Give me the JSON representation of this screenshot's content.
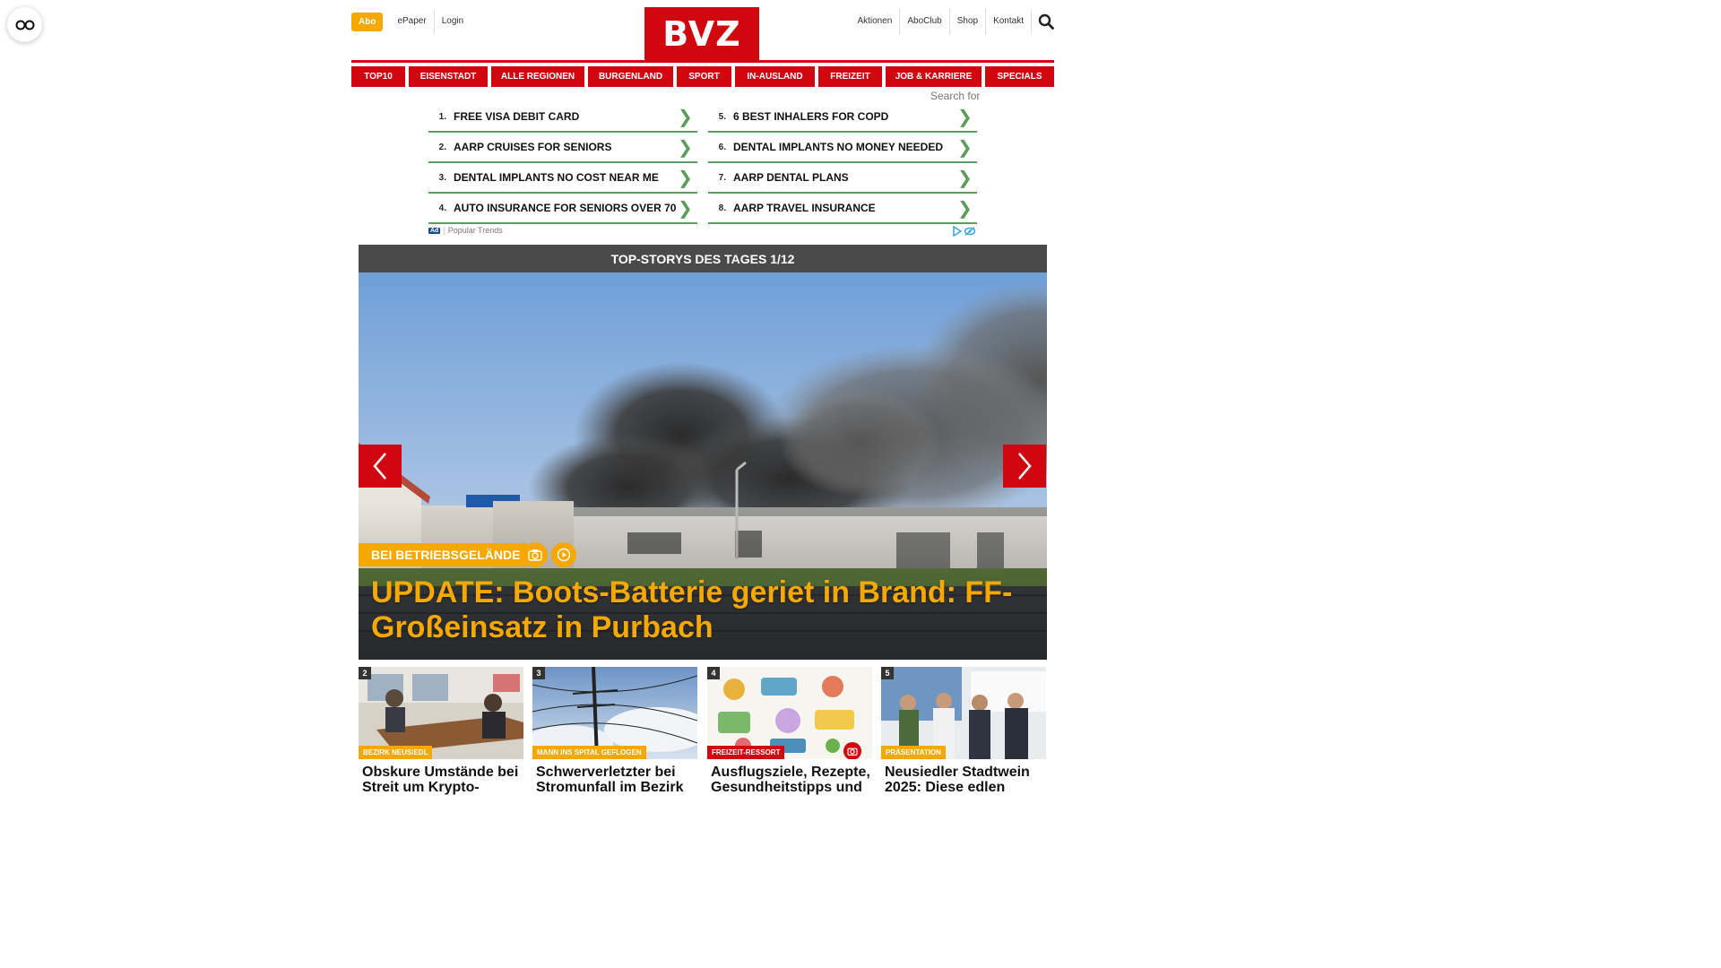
{
  "header": {
    "abo_label": "Abo",
    "left_links": [
      "ePaper",
      "Login"
    ],
    "logo_text": "BVZ",
    "right_links": [
      "Aktionen",
      "AboClub",
      "Shop",
      "Kontakt"
    ]
  },
  "nav": {
    "items": [
      "TOP10",
      "EISENSTADT",
      "ALLE REGIONEN",
      "BURGENLAND",
      "SPORT",
      "IN-AUSLAND",
      "FREIZEIT",
      "JOB & KARRIERE",
      "SPECIALS"
    ]
  },
  "ads": {
    "search_for": "Search for",
    "left": [
      {
        "num": "1.",
        "text": "FREE VISA DEBIT CARD"
      },
      {
        "num": "2.",
        "text": "AARP CRUISES FOR SENIORS"
      },
      {
        "num": "3.",
        "text": "DENTAL IMPLANTS NO COST NEAR ME"
      },
      {
        "num": "4.",
        "text": "AUTO INSURANCE FOR SENIORS OVER 70"
      }
    ],
    "right": [
      {
        "num": "5.",
        "text": "6 BEST INHALERS FOR COPD"
      },
      {
        "num": "6.",
        "text": "DENTAL IMPLANTS NO MONEY NEEDED"
      },
      {
        "num": "7.",
        "text": "AARP DENTAL PLANS"
      },
      {
        "num": "8.",
        "text": "AARP TRAVEL INSURANCE"
      }
    ],
    "chevron": "❯",
    "ad_badge": "Ad",
    "footer_label": "Popular Trends"
  },
  "stories": {
    "heading": "TOP-STORYS DES TAGES 1/12",
    "hero": {
      "kicker": "BEI BETRIEBSGELÄNDE",
      "title": "UPDATE: Boots-Batterie geriet in Brand: FF-Großeinsatz in Purbach"
    },
    "cards": [
      {
        "num": "2",
        "kicker": "BEZIRK NEUSIEDL",
        "title": "Obskure Umstände bei Streit um Krypto-"
      },
      {
        "num": "3",
        "kicker": "MANN INS SPITAL GEFLOGEN",
        "title": "Schwerverletzter bei Stromunfall im Bezirk"
      },
      {
        "num": "4",
        "kicker": "FREIZEIT-RESSORT",
        "title": "Ausflugsziele, Rezepte, Gesundheitstipps und"
      },
      {
        "num": "5",
        "kicker": "PRÄSENTATION",
        "title": "Neusiedler Stadtwein 2025: Diese edlen"
      }
    ]
  },
  "colors": {
    "brand_red": "#d1070f",
    "accent_yellow": "#f5a800",
    "ad_green": "#5b9e5b"
  }
}
